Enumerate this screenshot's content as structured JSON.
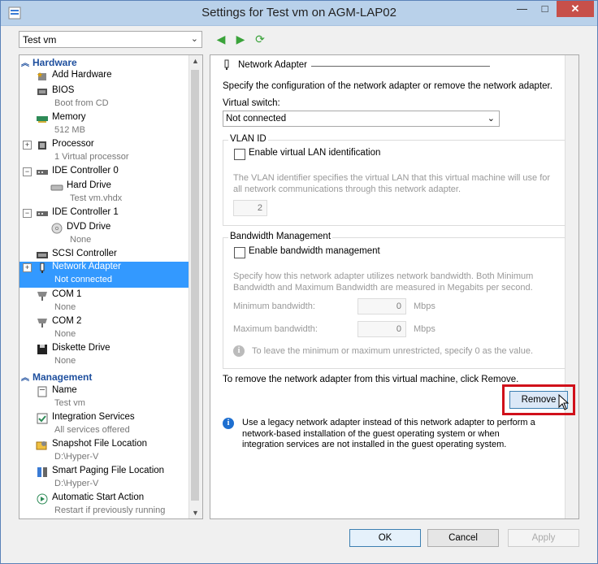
{
  "window": {
    "title": "Settings for Test vm on AGM-LAP02",
    "minimize": "—",
    "maximize": "□",
    "close": "✕"
  },
  "vm_select": {
    "value": "Test vm"
  },
  "toolbar": {
    "back_icon": "◀",
    "forward_icon": "▶",
    "refresh_icon": "⟳"
  },
  "tree": {
    "hardware_header": "Hardware",
    "management_header": "Management",
    "items": [
      {
        "label": "Add Hardware",
        "sub": ""
      },
      {
        "label": "BIOS",
        "sub": "Boot from CD"
      },
      {
        "label": "Memory",
        "sub": "512 MB"
      },
      {
        "label": "Processor",
        "sub": "1 Virtual processor"
      },
      {
        "label": "IDE Controller 0",
        "sub": ""
      },
      {
        "label": "Hard Drive",
        "sub": "Test vm.vhdx"
      },
      {
        "label": "IDE Controller 1",
        "sub": ""
      },
      {
        "label": "DVD Drive",
        "sub": "None"
      },
      {
        "label": "SCSI Controller",
        "sub": ""
      },
      {
        "label": "Network Adapter",
        "sub": "Not connected"
      },
      {
        "label": "COM 1",
        "sub": "None"
      },
      {
        "label": "COM 2",
        "sub": "None"
      },
      {
        "label": "Diskette Drive",
        "sub": "None"
      },
      {
        "label": "Name",
        "sub": "Test vm"
      },
      {
        "label": "Integration Services",
        "sub": "All services offered"
      },
      {
        "label": "Snapshot File Location",
        "sub": "D:\\Hyper-V"
      },
      {
        "label": "Smart Paging File Location",
        "sub": "D:\\Hyper-V"
      },
      {
        "label": "Automatic Start Action",
        "sub": "Restart if previously running"
      }
    ]
  },
  "panel": {
    "header": "Network Adapter",
    "description": "Specify the configuration of the network adapter or remove the network adapter.",
    "virtual_switch_label": "Virtual switch:",
    "virtual_switch_value": "Not connected",
    "vlan": {
      "title": "VLAN ID",
      "enable_label": "Enable virtual LAN identification",
      "info": "The VLAN identifier specifies the virtual LAN that this virtual machine will use for all network communications through this network adapter.",
      "value": "2"
    },
    "bandwidth": {
      "title": "Bandwidth Management",
      "enable_label": "Enable bandwidth management",
      "info": "Specify how this network adapter utilizes network bandwidth. Both Minimum Bandwidth and Maximum Bandwidth are measured in Megabits per second.",
      "min_label": "Minimum bandwidth:",
      "min_value": "0",
      "max_label": "Maximum bandwidth:",
      "max_value": "0",
      "unit": "Mbps",
      "tip": "To leave the minimum or maximum unrestricted, specify 0 as the value."
    },
    "remove_text": "To remove the network adapter from this virtual machine, click Remove.",
    "remove_button": "Remove",
    "legacy_info": "Use a legacy network adapter instead of this network adapter to perform a network-based installation of the guest operating system or when integration services are not installed in the guest operating system."
  },
  "footer": {
    "ok": "OK",
    "cancel": "Cancel",
    "apply": "Apply"
  },
  "colors": {
    "accent": "#1e4f9e",
    "selection": "#3399ff",
    "highlight_box": "#d0101a"
  }
}
